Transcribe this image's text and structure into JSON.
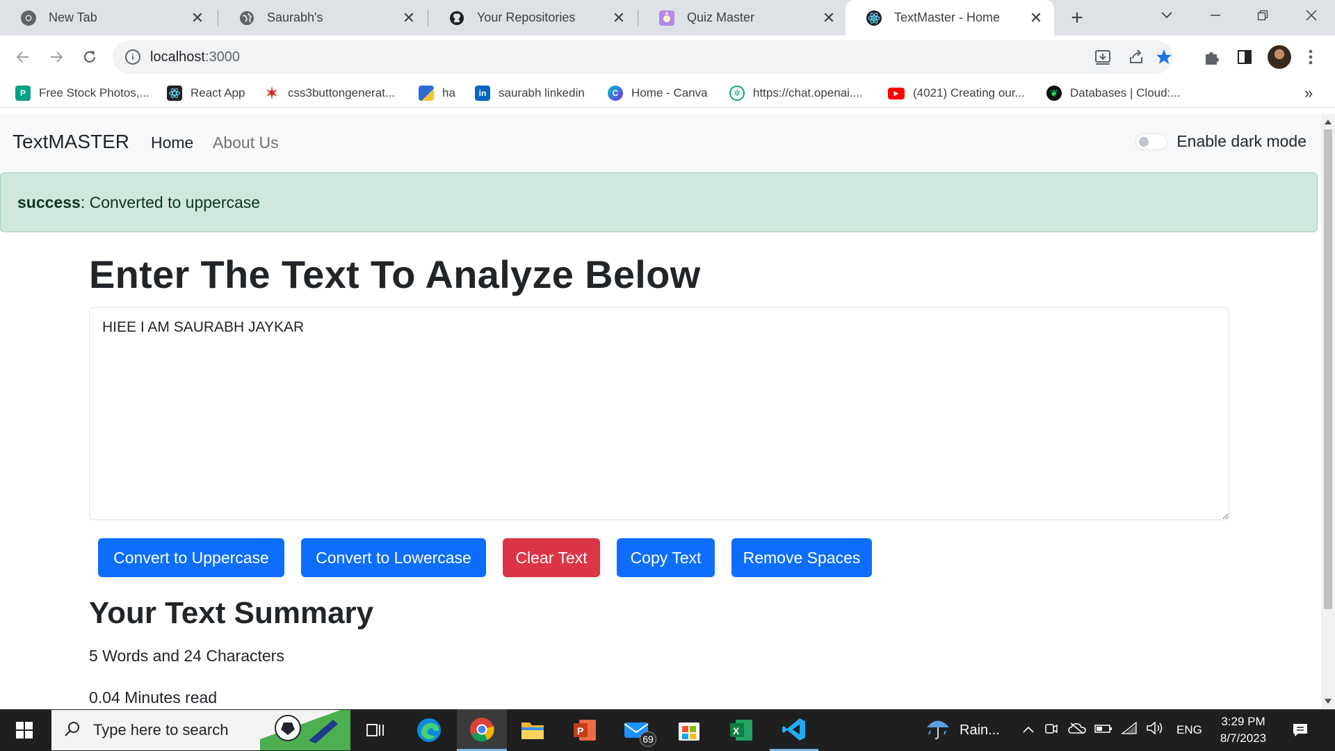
{
  "browser": {
    "tabs": [
      {
        "label": "New Tab",
        "active": false
      },
      {
        "label": "Saurabh's",
        "active": false
      },
      {
        "label": "Your Repositories",
        "active": false
      },
      {
        "label": "Quiz Master",
        "active": false
      },
      {
        "label": "TextMaster - Home",
        "active": true
      }
    ],
    "url_host": "localhost",
    "url_port": ":3000",
    "bookmarks": [
      {
        "label": "Free Stock Photos,...",
        "icon": "pexels-icon",
        "color": "#05a081"
      },
      {
        "label": "React App",
        "icon": "react-icon",
        "color": "#222222"
      },
      {
        "label": "css3buttongenerat...",
        "icon": "star-burst-icon",
        "color": "#e02020"
      },
      {
        "label": "ha",
        "icon": "cube-icon",
        "color": "#2b6cd4"
      },
      {
        "label": "saurabh linkedin",
        "icon": "linkedin-icon",
        "color": "#0a66c2"
      },
      {
        "label": "Home - Canva",
        "icon": "canva-icon",
        "color": "#7d2ae8"
      },
      {
        "label": "https://chat.openai....",
        "icon": "openai-icon",
        "color": "#10a37f"
      },
      {
        "label": "(4021) Creating our...",
        "icon": "youtube-icon",
        "color": "#ff0000"
      },
      {
        "label": "Databases | Cloud:...",
        "icon": "mongodb-icon",
        "color": "#00684a"
      }
    ],
    "more_bookmarks": "»"
  },
  "app": {
    "brand": "TextMASTER",
    "nav": {
      "home": "Home",
      "about": "About Us"
    },
    "dark_mode_label": "Enable dark mode",
    "dark_mode_on": false,
    "alert": {
      "type": "success",
      "message": ": Converted to uppercase",
      "color": "#d1e7dd"
    },
    "heading": "Enter The Text To Analyze Below",
    "textarea_value": "HIEE I AM SAURABH JAYKAR",
    "buttons": {
      "uppercase": "Convert to Uppercase",
      "lowercase": "Convert to Lowercase",
      "clear": "Clear Text",
      "copy": "Copy Text",
      "remove_spaces": "Remove Spaces"
    },
    "summary_title": "Your Text Summary",
    "summary_stats": "5 Words and 24 Characters",
    "read_time": "0.04 Minutes read",
    "colors": {
      "primary": "#0d6efd",
      "danger": "#dc3545"
    }
  },
  "taskbar": {
    "search_placeholder": "Type here to search",
    "mail_badge": "69",
    "weather": "Rain...",
    "language": "ENG",
    "time": "3:29 PM",
    "date": "8/7/2023"
  }
}
